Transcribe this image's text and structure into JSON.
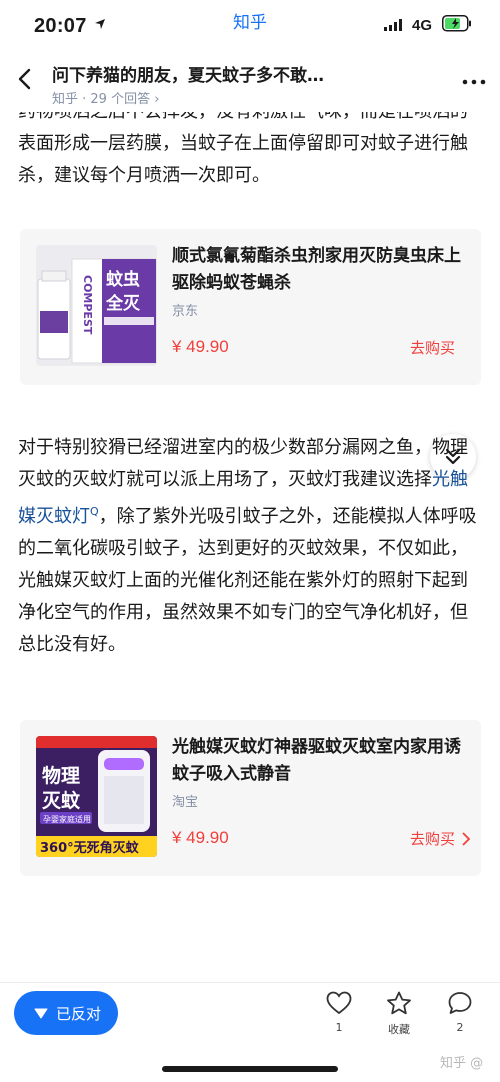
{
  "status_bar": {
    "time": "20:07",
    "app_name": "知乎",
    "network": "4G"
  },
  "header": {
    "title": "问下养猫的朋友，夏天蚊子多不敢…",
    "subtitle": "知乎 · 29 个回答 ›"
  },
  "article": {
    "paragraph1": "药物喷洒之后不会挥发，没有刺激性气味，而是在喷洒的表面形成一层药膜，当蚊子在上面停留即可对蚊子进行触杀，建议每个月喷洒一次即可。",
    "paragraph2_before": "对于特别狡猾已经溜进室内的极少数部分漏网之鱼，物理灭蚊的灭蚊灯就可以派上用场了，灭蚊灯我建议选择",
    "paragraph2_link": "光触媒灭蚊灯",
    "paragraph2_after": "，除了紫外光吸引蚊子之外，还能模拟人体呼吸的二氧化碳吸引蚊子，达到更好的灭蚊效果，不仅如此，光触媒灭蚊灯上面的光催化剂还能在紫外灯的照射下起到净化空气的作用，虽然效果不如专门的空气净化机好，但总比没有好。"
  },
  "products": [
    {
      "name": "顺式氯氰菊酯杀虫剂家用灭防臭虫床上驱除蚂蚁苍蝇杀",
      "shop": "京东",
      "price": "¥ 49.90",
      "buy_label": "去购买",
      "image_text": [
        "蚊虫",
        "全灭",
        "COMPEST"
      ]
    },
    {
      "name": "光触媒灭蚊灯神器驱蚊灭蚊室内家用诱蚊子吸入式静音",
      "shop": "淘宝",
      "price": "¥ 49.90",
      "buy_label": "去购买",
      "image_text": [
        "物理",
        "灭蚊",
        "孕婴家庭适用",
        "360°无死角灭蚊"
      ]
    }
  ],
  "bottom_bar": {
    "oppose_label": "已反对",
    "like_count": "1",
    "collect_label": "收藏",
    "comment_count": "2",
    "watermark": "知乎 @"
  },
  "colors": {
    "brand_blue": "#1772f6",
    "price_red": "#f1403c",
    "link_blue": "#175199"
  }
}
